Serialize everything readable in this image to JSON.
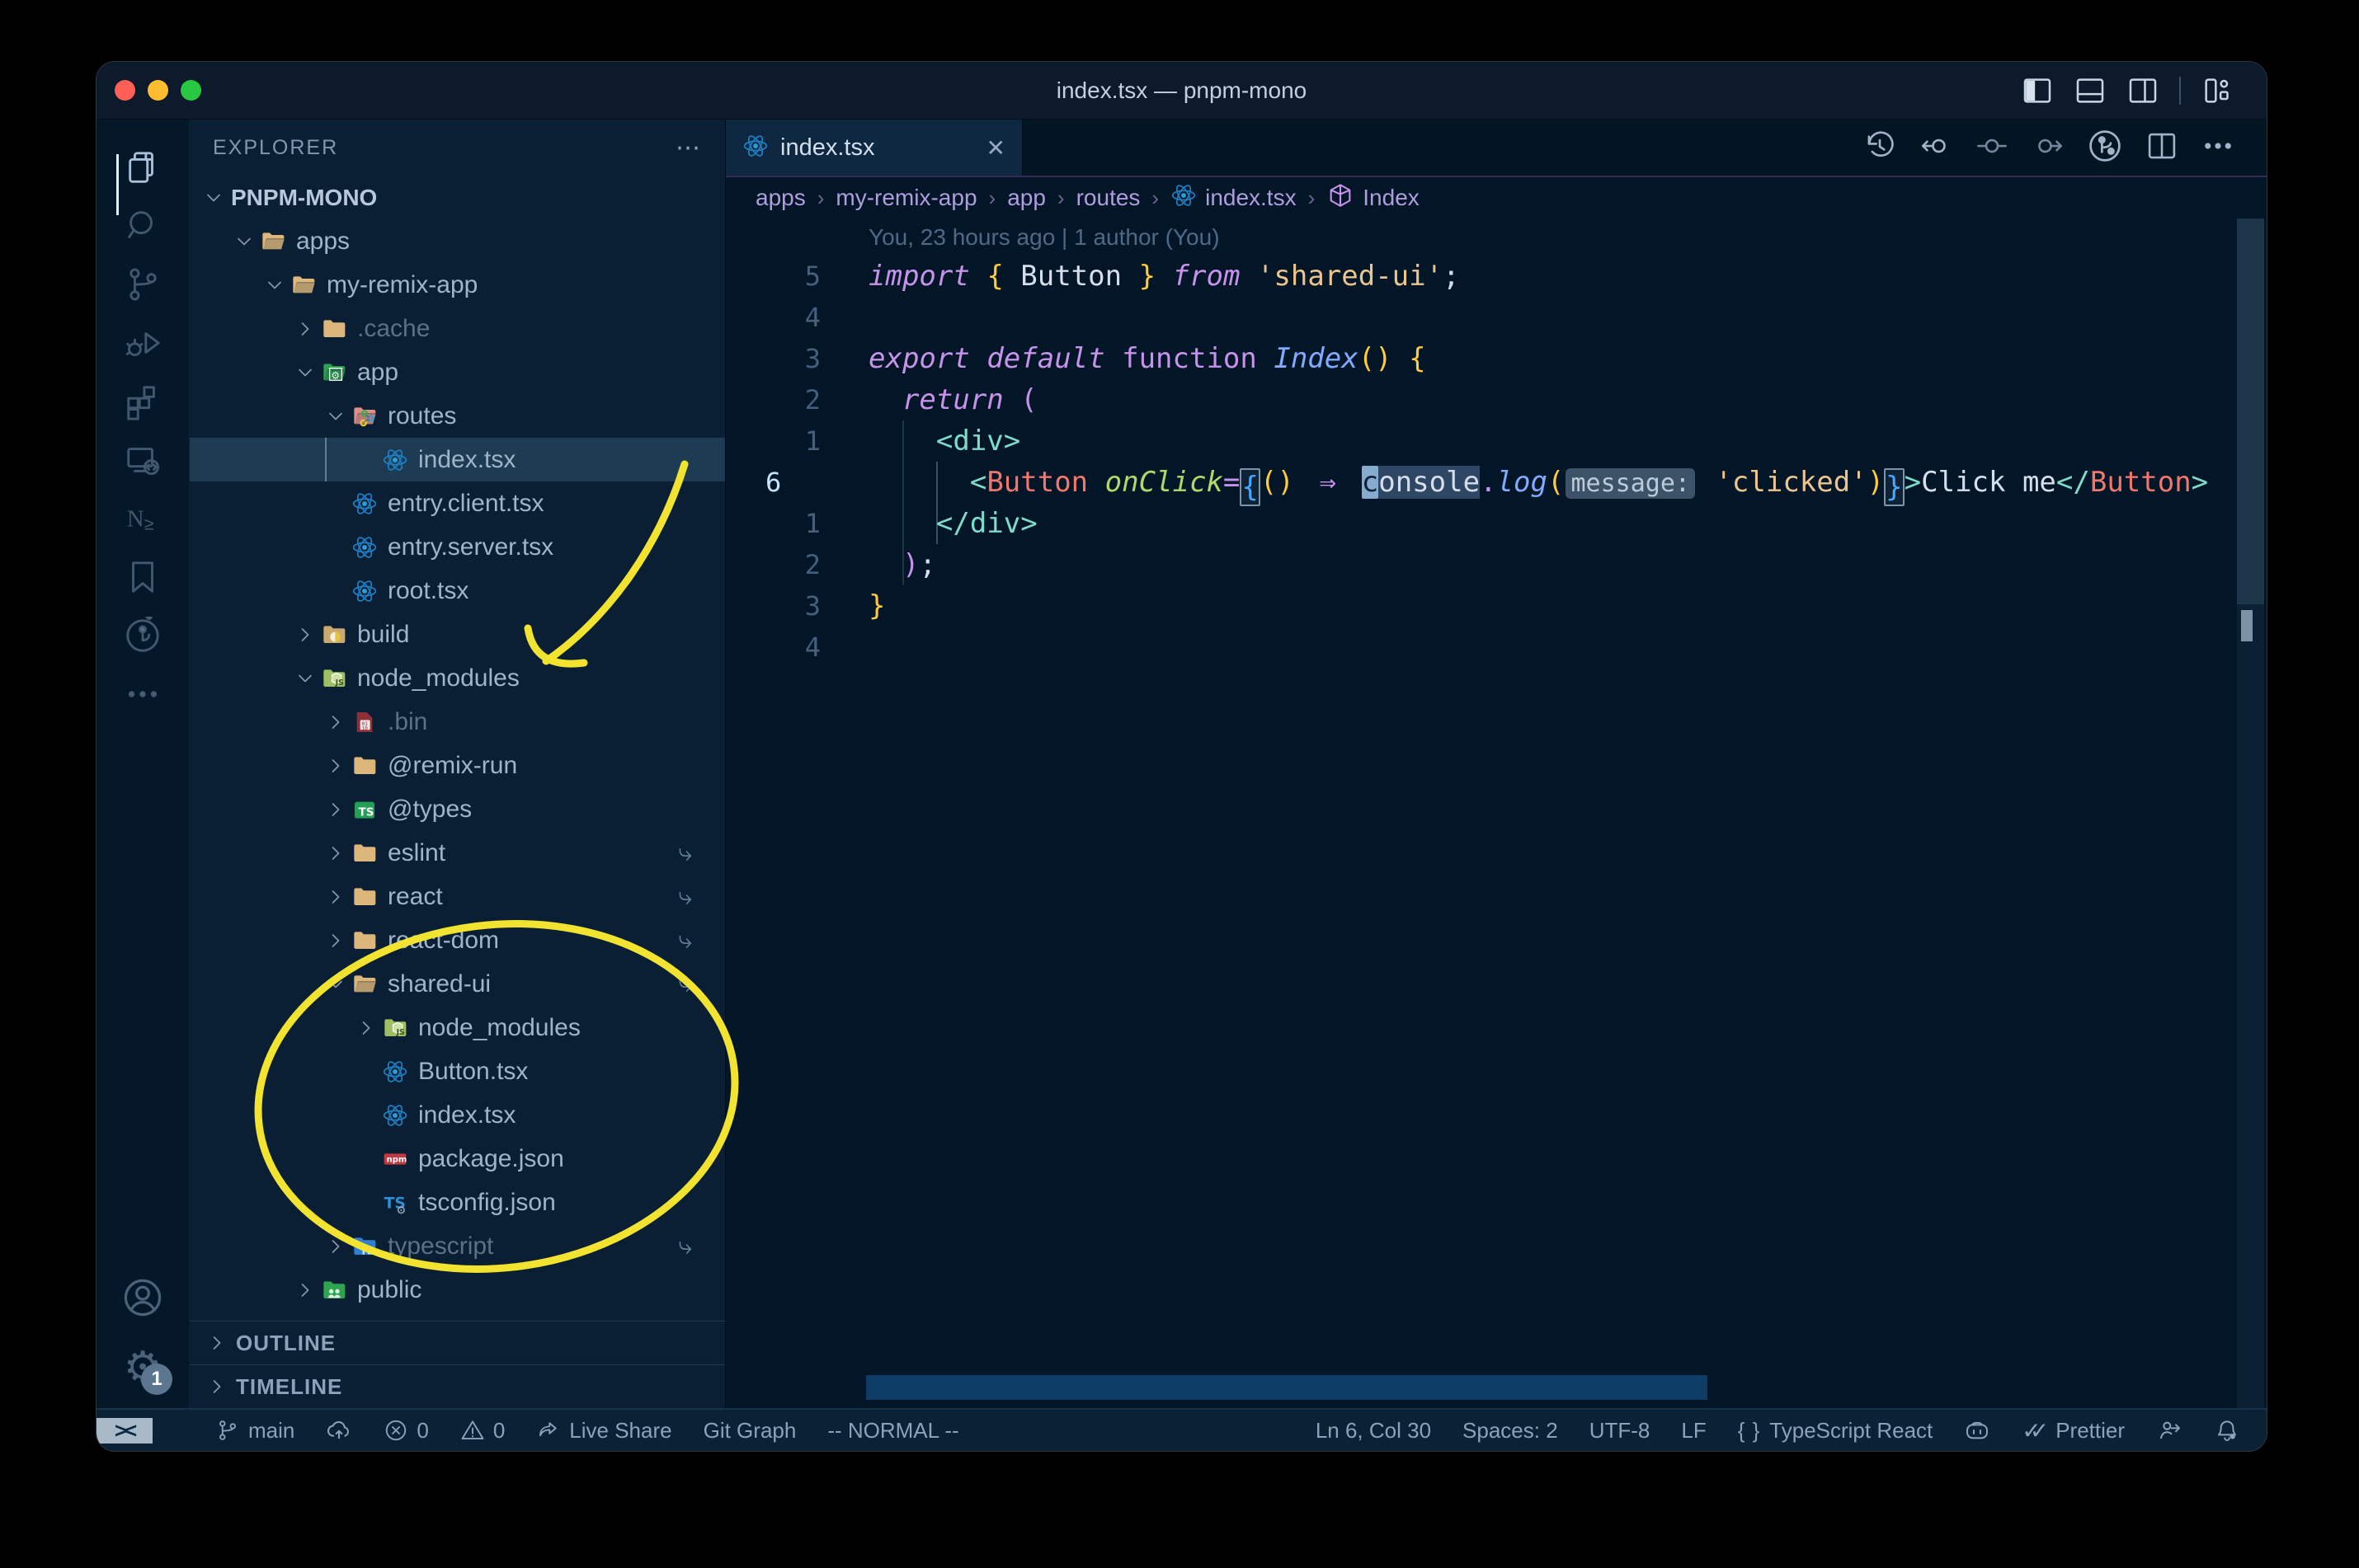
{
  "window": {
    "title": "index.tsx — pnpm-mono"
  },
  "colors": {
    "annotation_yellow": "#f2e330",
    "editor_bg": "#011627",
    "sidebar_bg": "#0a1f33",
    "selection_bg": "#1d3b53",
    "accent_purple": "#c792ea",
    "accent_teal": "#7fdbca",
    "accent_gold": "#ffcb3d",
    "accent_blue": "#82aaff",
    "accent_salmon": "#f0776b",
    "accent_green": "#addb67",
    "string_peach": "#ecc48d",
    "folder_tan": "#dcb67a",
    "react_blue": "#2d9fd8"
  },
  "activity_bar": {
    "items": [
      {
        "name": "explorer",
        "icon": "files",
        "active": true
      },
      {
        "name": "search",
        "icon": "search"
      },
      {
        "name": "source-control",
        "icon": "scm"
      },
      {
        "name": "run-debug",
        "icon": "debug"
      },
      {
        "name": "extensions",
        "icon": "extensions"
      },
      {
        "name": "remote-explorer",
        "icon": "remote"
      },
      {
        "name": "nx-console",
        "icon": "nx"
      },
      {
        "name": "bookmarks",
        "icon": "bookmark"
      },
      {
        "name": "gitlens",
        "icon": "gitlens"
      },
      {
        "name": "more-views",
        "icon": "more"
      }
    ],
    "bottom": [
      {
        "name": "account",
        "icon": "account"
      },
      {
        "name": "settings",
        "icon": "gear",
        "badge": "1"
      }
    ]
  },
  "explorer": {
    "header": "EXPLORER",
    "more_label": "⋯",
    "tree": [
      {
        "label": "PNPM-MONO",
        "depth": 0,
        "chevron": "down",
        "root": true
      },
      {
        "label": "apps",
        "depth": 1,
        "chevron": "down",
        "icon": "folder-open"
      },
      {
        "label": "my-remix-app",
        "depth": 2,
        "chevron": "down",
        "icon": "folder-open"
      },
      {
        "label": ".cache",
        "depth": 3,
        "chevron": "right",
        "icon": "folder",
        "dim": true
      },
      {
        "label": "app",
        "depth": 3,
        "chevron": "down",
        "icon": "folder-app"
      },
      {
        "label": "routes",
        "depth": 4,
        "chevron": "down",
        "icon": "folder-routes"
      },
      {
        "label": "index.tsx",
        "depth": 5,
        "icon": "react",
        "selected": true,
        "guide": true
      },
      {
        "label": "entry.client.tsx",
        "depth": 4,
        "icon": "react"
      },
      {
        "label": "entry.server.tsx",
        "depth": 4,
        "icon": "react"
      },
      {
        "label": "root.tsx",
        "depth": 4,
        "icon": "react"
      },
      {
        "label": "build",
        "depth": 3,
        "chevron": "right",
        "icon": "folder-build"
      },
      {
        "label": "node_modules",
        "depth": 3,
        "chevron": "down",
        "icon": "folder-js"
      },
      {
        "label": ".bin",
        "depth": 4,
        "chevron": "right",
        "icon": "file-bin",
        "dim": true
      },
      {
        "label": "@remix-run",
        "depth": 4,
        "chevron": "right",
        "icon": "folder"
      },
      {
        "label": "@types",
        "depth": 4,
        "chevron": "right",
        "icon": "folder-ts-green"
      },
      {
        "label": "eslint",
        "depth": 4,
        "chevron": "right",
        "icon": "folder",
        "symlink": true
      },
      {
        "label": "react",
        "depth": 4,
        "chevron": "right",
        "icon": "folder",
        "symlink": true
      },
      {
        "label": "react-dom",
        "depth": 4,
        "chevron": "right",
        "icon": "folder",
        "symlink": true
      },
      {
        "label": "shared-ui",
        "depth": 4,
        "chevron": "down",
        "icon": "folder-open",
        "symlink": true
      },
      {
        "label": "node_modules",
        "depth": 5,
        "chevron": "right",
        "icon": "folder-js"
      },
      {
        "label": "Button.tsx",
        "depth": 5,
        "icon": "react"
      },
      {
        "label": "index.tsx",
        "depth": 5,
        "icon": "react"
      },
      {
        "label": "package.json",
        "depth": 5,
        "icon": "npm"
      },
      {
        "label": "tsconfig.json",
        "depth": 5,
        "icon": "ts-gear"
      },
      {
        "label": "typescript",
        "depth": 4,
        "chevron": "right",
        "icon": "folder-ts-blue",
        "dim": true,
        "symlink": true
      },
      {
        "label": "public",
        "depth": 3,
        "chevron": "right",
        "icon": "folder-public"
      }
    ],
    "sections": [
      {
        "label": "OUTLINE"
      },
      {
        "label": "TIMELINE"
      }
    ]
  },
  "tabs": [
    {
      "label": "index.tsx",
      "icon": "react",
      "close": "✕",
      "active": true
    }
  ],
  "breadcrumbs": [
    {
      "label": "apps"
    },
    {
      "label": "my-remix-app"
    },
    {
      "label": "app"
    },
    {
      "label": "routes"
    },
    {
      "label": "index.tsx",
      "icon": "react"
    },
    {
      "label": "Index",
      "icon": "symbol-cube"
    }
  ],
  "editor": {
    "blame": "You, 23 hours ago | 1 author (You)",
    "lines": [
      {
        "rel": "5",
        "tokens": [
          [
            "import",
            "kwi"
          ],
          [
            " ",
            "fg"
          ],
          [
            "{",
            "gold"
          ],
          [
            " Button ",
            "fg"
          ],
          [
            "}",
            "gold"
          ],
          [
            " ",
            "fg"
          ],
          [
            "from",
            "kwi"
          ],
          [
            " ",
            "fg"
          ],
          [
            "'shared-ui'",
            "str"
          ],
          [
            ";",
            "fg"
          ]
        ]
      },
      {
        "rel": "4",
        "tokens": []
      },
      {
        "rel": "3",
        "tokens": [
          [
            "export",
            "kwi"
          ],
          [
            " ",
            "fg"
          ],
          [
            "default",
            "kwi"
          ],
          [
            " ",
            "fg"
          ],
          [
            "function",
            "kw"
          ],
          [
            " ",
            "fg"
          ],
          [
            "Index",
            "bluei"
          ],
          [
            "()",
            "gold"
          ],
          [
            " ",
            "fg"
          ],
          [
            "{",
            "gold"
          ]
        ]
      },
      {
        "rel": "2",
        "tokens": [
          [
            "  ",
            "fg"
          ],
          [
            "return",
            "kwi"
          ],
          [
            " ",
            "fg"
          ],
          [
            "(",
            "pp"
          ]
        ]
      },
      {
        "rel": "1",
        "tokens": [
          [
            "    ",
            "fg"
          ],
          [
            "<div>",
            "teal"
          ]
        ]
      },
      {
        "rel": "6",
        "current": true,
        "tokens": [
          [
            "      ",
            "fg"
          ],
          [
            "<",
            "teal"
          ],
          [
            "Button",
            "salmon"
          ],
          [
            " ",
            "fg"
          ],
          [
            "onClick",
            "gri"
          ],
          [
            "=",
            "pp"
          ],
          [
            "{",
            "bbox"
          ],
          [
            "()",
            "gold"
          ],
          [
            " ",
            "fg"
          ],
          [
            "⇒",
            "arrow"
          ],
          [
            " ",
            "fg"
          ],
          [
            "c",
            "cur"
          ],
          [
            "onsole",
            "whl"
          ],
          [
            ".",
            "pp"
          ],
          [
            "log",
            "bluei"
          ],
          [
            "(",
            "gold"
          ],
          [
            "message:",
            "inlay"
          ],
          [
            " ",
            "fg"
          ],
          [
            "'clicked'",
            "str"
          ],
          [
            ")",
            "gold"
          ],
          [
            "}",
            "bbox"
          ],
          [
            ">",
            "teal"
          ],
          [
            "Click me",
            "fg"
          ],
          [
            "</",
            "teal"
          ],
          [
            "Button",
            "salmon"
          ],
          [
            ">",
            "teal"
          ]
        ]
      },
      {
        "rel": "1",
        "tokens": [
          [
            "    ",
            "fg"
          ],
          [
            "</div>",
            "teal"
          ]
        ]
      },
      {
        "rel": "2",
        "tokens": [
          [
            "  ",
            "fg"
          ],
          [
            ")",
            "pp"
          ],
          [
            ";",
            "fg"
          ]
        ]
      },
      {
        "rel": "3",
        "tokens": [
          [
            "}",
            "gold"
          ]
        ]
      },
      {
        "rel": "4",
        "tokens": []
      }
    ]
  },
  "editor_actions": [
    {
      "name": "timeline-history",
      "icon": "history"
    },
    {
      "name": "previous-change",
      "icon": "prev-change"
    },
    {
      "name": "current-change",
      "icon": "mid-change"
    },
    {
      "name": "next-change",
      "icon": "next-change"
    },
    {
      "name": "gitlens-graph",
      "icon": "branch-circle"
    },
    {
      "name": "split-editor",
      "icon": "split"
    },
    {
      "name": "more-actions",
      "icon": "ellipsis"
    }
  ],
  "titlebar_controls": [
    {
      "name": "toggle-primary-sidebar",
      "icon": "layout-sidebar-left"
    },
    {
      "name": "toggle-panel",
      "icon": "layout-panel"
    },
    {
      "name": "toggle-secondary-sidebar",
      "icon": "layout-sidebar-right"
    },
    {
      "name": "separator",
      "icon": "sep"
    },
    {
      "name": "customize-layout",
      "icon": "layout-customize"
    }
  ],
  "status_bar": {
    "left": [
      {
        "name": "remote-indicator",
        "remote": true,
        "label": "><"
      },
      {
        "name": "git-branch",
        "icon": "branch",
        "label": "main"
      },
      {
        "name": "publish",
        "icon": "cloud-upload"
      },
      {
        "name": "errors",
        "icon": "error",
        "label": "0"
      },
      {
        "name": "warnings",
        "icon": "warning",
        "label": "0"
      },
      {
        "name": "live-share",
        "icon": "live-share",
        "label": "Live Share"
      },
      {
        "name": "git-graph",
        "label": "Git Graph"
      },
      {
        "name": "vim-mode",
        "label": "-- NORMAL --"
      }
    ],
    "right": [
      {
        "name": "cursor-position",
        "label": "Ln 6, Col 30"
      },
      {
        "name": "indentation",
        "label": "Spaces: 2"
      },
      {
        "name": "encoding",
        "label": "UTF-8"
      },
      {
        "name": "eol",
        "label": "LF"
      },
      {
        "name": "language-mode",
        "icon": "brackets",
        "label": "TypeScript React"
      },
      {
        "name": "copilot",
        "icon": "copilot"
      },
      {
        "name": "prettier",
        "icon": "double-check",
        "label": "Prettier"
      },
      {
        "name": "feedback",
        "icon": "feedback"
      },
      {
        "name": "notifications",
        "icon": "bell-dot"
      }
    ]
  }
}
